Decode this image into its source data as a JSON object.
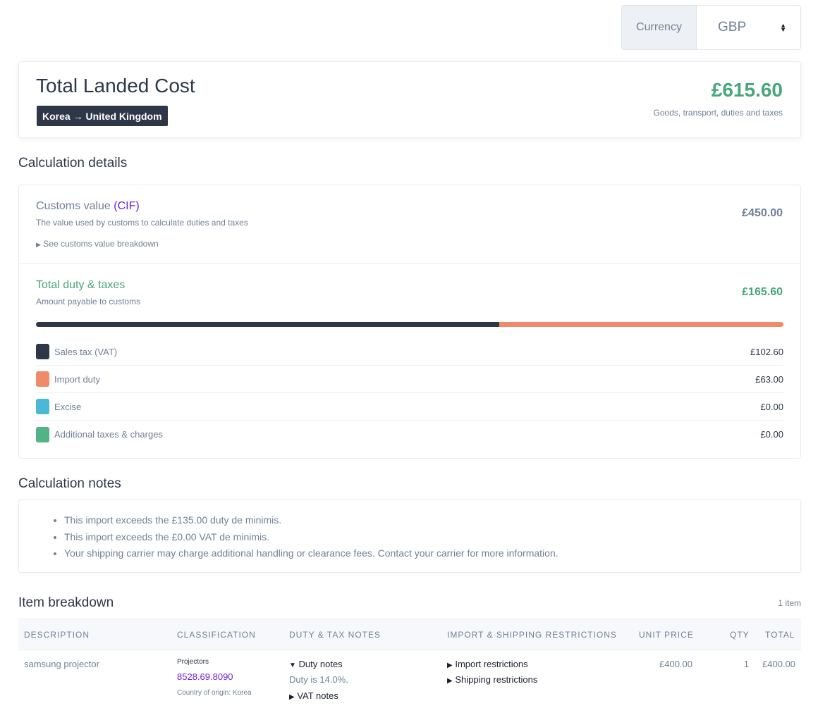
{
  "currency": {
    "label": "Currency",
    "value": "GBP"
  },
  "total": {
    "title": "Total Landed Cost",
    "route": "Korea → United Kingdom",
    "amount": "£615.60",
    "subtitle": "Goods, transport, duties and taxes"
  },
  "details": {
    "section_title": "Calculation details",
    "customs": {
      "label": "Customs value",
      "cif": "(CIF)",
      "description": "The value used by customs to calculate duties and taxes",
      "toggle": "See customs value breakdown",
      "value": "£450.00"
    },
    "duty": {
      "label": "Total duty & taxes",
      "description": "Amount payable to customs",
      "value": "£165.60",
      "bar": [
        {
          "name": "Sales tax (VAT)",
          "fraction": 0.6196,
          "color": "#2d3748"
        },
        {
          "name": "Import duty",
          "fraction": 0.3804,
          "color": "#f08a6b"
        }
      ],
      "items": [
        {
          "name": "Sales tax (VAT)",
          "amount": "£102.60",
          "color": "#2d3748"
        },
        {
          "name": "Import duty",
          "amount": "£63.00",
          "color": "#f08a6b"
        },
        {
          "name": "Excise",
          "amount": "£0.00",
          "color": "#4cb8d8"
        },
        {
          "name": "Additional taxes & charges",
          "amount": "£0.00",
          "color": "#52b386"
        }
      ]
    }
  },
  "notes": {
    "section_title": "Calculation notes",
    "items": [
      "This import exceeds the £135.00 duty de minimis.",
      "This import exceeds the £0.00 VAT de minimis.",
      "Your shipping carrier may charge additional handling or clearance fees. Contact your carrier for more information."
    ]
  },
  "breakdown": {
    "section_title": "Item breakdown",
    "count": "1 item",
    "headers": {
      "description": "DESCRIPTION",
      "classification": "CLASSIFICATION",
      "notes": "DUTY & TAX NOTES",
      "restrictions": "IMPORT & SHIPPING RESTRICTIONS",
      "unit_price": "UNIT PRICE",
      "qty": "QTY",
      "total": "TOTAL"
    },
    "row": {
      "description": "samsung projector",
      "class_name": "Projectors",
      "hs_code": "8528.69.8090",
      "origin": "Country of origin: Korea",
      "duty_notes": "Duty notes",
      "duty_text": "Duty is 14.0%.",
      "vat_notes": "VAT notes",
      "import_restrictions": "Import restrictions",
      "shipping_restrictions": "Shipping restrictions",
      "unit_price": "£400.00",
      "qty": "1",
      "total": "£400.00"
    }
  }
}
